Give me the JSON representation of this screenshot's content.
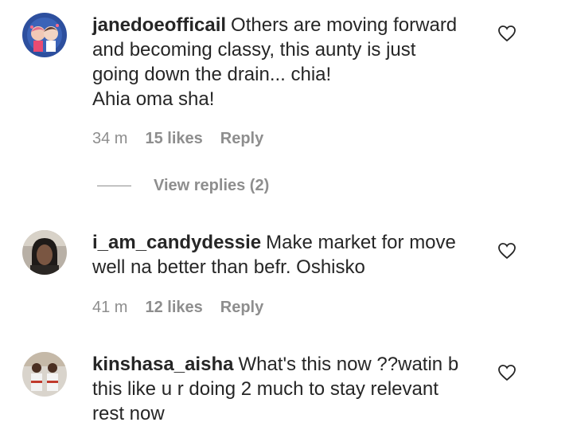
{
  "comments": [
    {
      "username": "janedoeofficail",
      "text_lines": [
        "Others are moving forward",
        "and becoming classy, this aunty is just",
        "going down the drain... chia!",
        "Ahia oma sha!"
      ],
      "time": "34 m",
      "likes": "15 likes",
      "reply": "Reply",
      "view_replies": "View replies (2)"
    },
    {
      "username": "i_am_candydessie",
      "text_lines": [
        "Make market for move",
        "well na better than befr. Oshisko"
      ],
      "time": "41 m",
      "likes": "12 likes",
      "reply": "Reply"
    },
    {
      "username": "kinshasa_aisha",
      "text_lines": [
        "What's this now ??watin b",
        "this like u r doing 2 much to stay relevant",
        "rest now"
      ]
    }
  ],
  "icons": {
    "like": "heart-outline-icon"
  }
}
